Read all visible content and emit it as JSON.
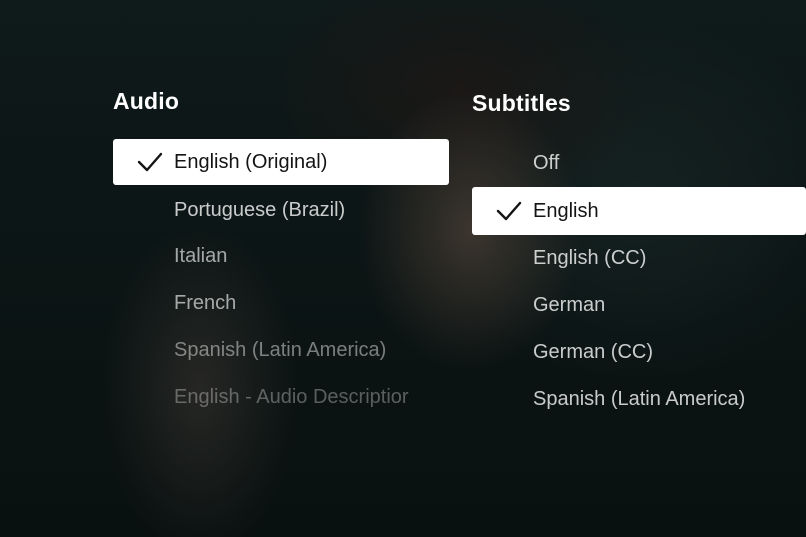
{
  "audio": {
    "title": "Audio",
    "options": [
      {
        "label": "English (Original)",
        "selected": true
      },
      {
        "label": "Portuguese (Brazil)",
        "selected": false
      },
      {
        "label": "Italian",
        "selected": false
      },
      {
        "label": "French",
        "selected": false
      },
      {
        "label": "Spanish (Latin America)",
        "selected": false
      },
      {
        "label": "English - Audio Descriptior",
        "selected": false
      }
    ]
  },
  "subtitles": {
    "title": "Subtitles",
    "options": [
      {
        "label": "Off",
        "selected": false
      },
      {
        "label": "English",
        "selected": true
      },
      {
        "label": "English (CC)",
        "selected": false
      },
      {
        "label": "German",
        "selected": false
      },
      {
        "label": "German (CC)",
        "selected": false
      },
      {
        "label": "Spanish (Latin America)",
        "selected": false
      }
    ]
  },
  "icons": {
    "selected_indicator": "checkmark-icon"
  },
  "colors": {
    "selected_background": "#ffffff",
    "selected_text": "#141414",
    "unselected_text": "#ffffff"
  }
}
